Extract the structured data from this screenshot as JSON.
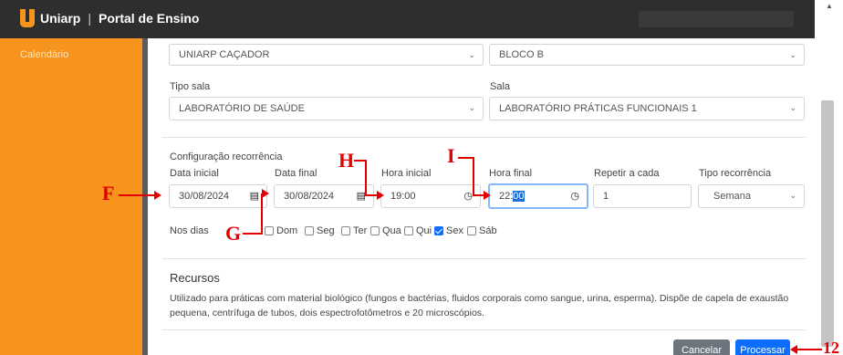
{
  "header": {
    "brand": "Uniarp",
    "separator": "|",
    "title": "Portal de Ensino"
  },
  "sidebar": {
    "items": [
      {
        "label": "Calendário"
      }
    ]
  },
  "form": {
    "campus_value": "UNIARP CAÇADOR",
    "bloco_value": "BLOCO B",
    "tipo_sala_label": "Tipo sala",
    "tipo_sala_value": "LABORATÓRIO DE SAÚDE",
    "sala_label": "Sala",
    "sala_value": "LABORATÓRIO PRÁTICAS FUNCIONAIS 1",
    "recorrencia_title": "Configuração recorrência",
    "data_inicial_label": "Data inicial",
    "data_inicial_value": "30/08/2024",
    "data_final_label": "Data final",
    "data_final_value": "30/08/2024",
    "hora_inicial_label": "Hora inicial",
    "hora_inicial_value": "19:00",
    "hora_final_label": "Hora final",
    "hora_final_hours": "22:",
    "hora_final_minutes": "00",
    "repetir_label": "Repetir a cada",
    "repetir_value": "1",
    "tipo_recorrencia_label": "Tipo recorrência",
    "tipo_recorrencia_value": "Semana",
    "nos_dias_label": "Nos dias",
    "days": [
      {
        "label": "Dom",
        "checked": false
      },
      {
        "label": "Seg",
        "checked": false
      },
      {
        "label": "Ter",
        "checked": false
      },
      {
        "label": "Qua",
        "checked": false
      },
      {
        "label": "Qui",
        "checked": false
      },
      {
        "label": "Sex",
        "checked": true
      },
      {
        "label": "Sáb",
        "checked": false
      }
    ]
  },
  "recursos": {
    "title": "Recursos",
    "line1": "Utilizado para práticas com material biológico (fungos e bactérias, fluidos corporais como sangue, urina, esperma). Dispõe de capela de exaustão",
    "line2": "pequena, centrífuga de tubos, dois espectrofotômetros e 20 microscópios."
  },
  "buttons": {
    "cancel": "Cancelar",
    "process": "Processar"
  },
  "annotations": {
    "F": "F",
    "G": "G",
    "H": "H",
    "I": "I",
    "n12": "12"
  },
  "colors": {
    "sidebar": "#f7941d",
    "topbar": "#2e2e2e",
    "primary": "#0d6efd",
    "annotation": "#e30000"
  }
}
